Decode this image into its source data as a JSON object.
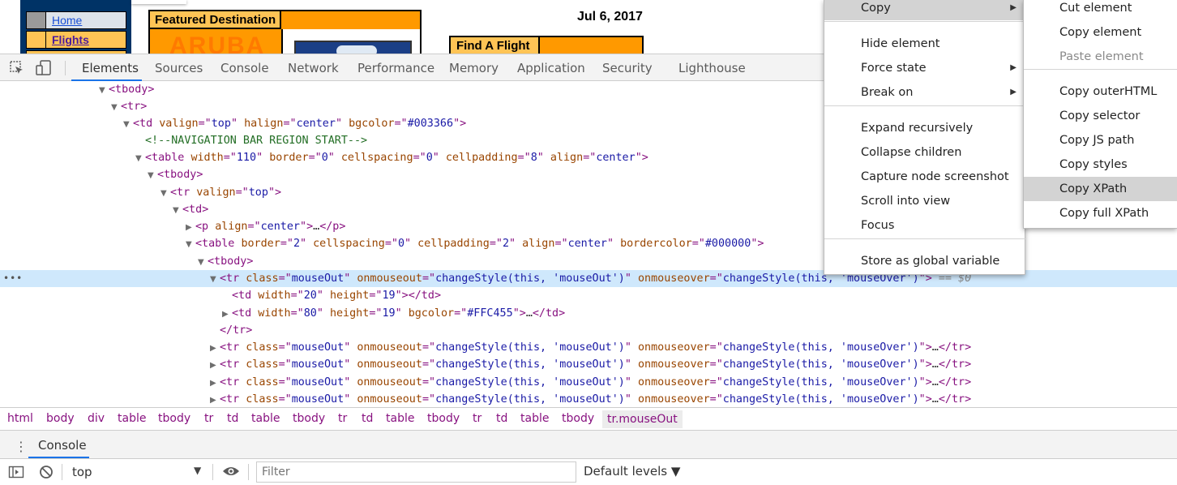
{
  "page_preview": {
    "nav_links": [
      "Home",
      "Flights"
    ],
    "featured_header": "Featured Destination",
    "featured_big_text": "ARUBA",
    "date": "Jul 6, 2017",
    "find_flight": "Find A Flight"
  },
  "devtools": {
    "tabs": [
      "Elements",
      "Sources",
      "Console",
      "Network",
      "Performance",
      "Memory",
      "Application",
      "Security",
      "Lighthouse"
    ],
    "active_tab": "Elements",
    "dom_lines": [
      "<tbody>",
      "<tr>",
      "<td valign=\"top\" halign=\"center\" bgcolor=\"#003366\">",
      "<!--NAVIGATION BAR REGION START-->",
      "<table width=\"110\" border=\"0\" cellspacing=\"0\" cellpadding=\"8\" align=\"center\">",
      "<tbody>",
      "<tr valign=\"top\">",
      "<td>",
      "<p align=\"center\">…</p>",
      "<table border=\"2\" cellspacing=\"0\" cellpadding=\"2\" align=\"center\" bordercolor=\"#000000\">",
      "<tbody>",
      "<tr class=\"mouseOut\" onmouseout=\"changeStyle(this, 'mouseOut')\" onmouseover=\"changeStyle(this, 'mouseOver')\"> == $0",
      "<td width=\"20\" height=\"19\"></td>",
      "<td width=\"80\" height=\"19\" bgcolor=\"#FFC455\">…</td>",
      "</tr>",
      "<tr class=\"mouseOut\" onmouseout=\"changeStyle(this, 'mouseOut')\" onmouseover=\"changeStyle(this, 'mouseOver')\">…</tr>",
      "<tr class=\"mouseOut\" onmouseout=\"changeStyle(this, 'mouseOut')\" onmouseover=\"changeStyle(this, 'mouseOver')\">…</tr>",
      "<tr class=\"mouseOut\" onmouseout=\"changeStyle(this, 'mouseOut')\" onmouseover=\"changeStyle(this, 'mouseOver')\">…</tr>",
      "<tr class=\"mouseOut\" onmouseout=\"changeStyle(this, 'mouseOut')\" onmouseover=\"changeStyle(this, 'mouseOver')\">…</tr>"
    ],
    "breadcrumbs": [
      "html",
      "body",
      "div",
      "table",
      "tbody",
      "tr",
      "td",
      "table",
      "tbody",
      "tr",
      "td",
      "table",
      "tbody",
      "tr",
      "td",
      "table",
      "tbody",
      "tr.mouseOut"
    ],
    "drawer_tab": "Console",
    "console_context": "top",
    "filter_placeholder": "Filter",
    "levels_label": "Default levels ▼",
    "dots": "•••"
  },
  "context_menu": {
    "items": [
      "Copy",
      "Hide element",
      "Force state",
      "Break on",
      "Expand recursively",
      "Collapse children",
      "Capture node screenshot",
      "Scroll into view",
      "Focus",
      "Store as global variable"
    ],
    "highlighted": "Copy"
  },
  "copy_submenu": {
    "items": [
      "Cut element",
      "Copy element",
      "Paste element",
      "Copy outerHTML",
      "Copy selector",
      "Copy JS path",
      "Copy styles",
      "Copy XPath",
      "Copy full XPath"
    ],
    "disabled": "Paste element",
    "highlighted": "Copy XPath"
  },
  "colors": {
    "nav_bg": "#003366",
    "nav_link_bg": "#FFC455",
    "featured_orange": "#FF9900",
    "selected_row": "#CFE8FC",
    "accent": "#1A73E8",
    "tag": "#881280",
    "attr_name": "#994500",
    "attr_value": "#1A1AA6",
    "comment": "#236E25"
  }
}
